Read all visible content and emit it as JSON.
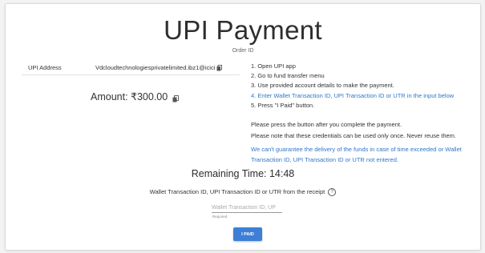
{
  "header": {
    "title": "UPI Payment",
    "order_id_label": "Order ID"
  },
  "address": {
    "label": "UPI Address",
    "value": "Vdcloudtechnologiesprivatelimited.ibz1@icici",
    "copy_icon": "copy-icon"
  },
  "amount": {
    "text": "Amount: ₹300.00",
    "copy_icon": "copy-icon"
  },
  "steps": [
    "1. Open UPI app",
    "2. Go to fund transfer menu",
    "3. Use provided account details to make the payment.",
    "4. Enter Wallet Transaction ID, UPI Transaction ID or UTR in the input below",
    "5. Press \"I Paid\" button."
  ],
  "notes": {
    "press_button": "Please press the button after you complete the payment.",
    "credentials_once": "Please note that these credentials can be used only once. Never reuse them.",
    "no_guarantee": "We can't guarantee the delivery of the funds in case of time exceeded or Wallet Transaction ID, UPI Transaction ID or UTR not entered."
  },
  "timer": {
    "text": "Remaining Time: 14:48"
  },
  "receipt": {
    "label": "Wallet Transaction ID, UPI Transaction ID or UTR from the receipt",
    "help_icon": "help-icon",
    "input_placeholder": "Wallet Transaction ID, UP",
    "input_value": "",
    "required_text": "Required"
  },
  "actions": {
    "paid_label": "I PAID"
  },
  "colors": {
    "accent": "#3d7fd6",
    "link_blue": "#2f76c9",
    "background": "#f3f3f3"
  }
}
